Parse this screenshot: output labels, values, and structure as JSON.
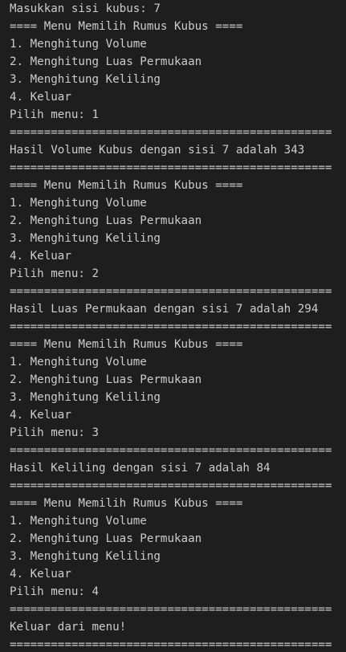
{
  "terminal": {
    "lines": [
      "Masukkan sisi kubus: 7",
      "==== Menu Memilih Rumus Kubus ====",
      "1. Menghitung Volume",
      "2. Menghitung Luas Permukaan",
      "3. Menghitung Keliling",
      "4. Keluar",
      "Pilih menu: 1",
      "===============================================",
      "Hasil Volume Kubus dengan sisi 7 adalah 343",
      "===============================================",
      "==== Menu Memilih Rumus Kubus ====",
      "1. Menghitung Volume",
      "2. Menghitung Luas Permukaan",
      "3. Menghitung Keliling",
      "4. Keluar",
      "Pilih menu: 2",
      "===============================================",
      "Hasil Luas Permukaan dengan sisi 7 adalah 294",
      "===============================================",
      "==== Menu Memilih Rumus Kubus ====",
      "1. Menghitung Volume",
      "2. Menghitung Luas Permukaan",
      "3. Menghitung Keliling",
      "4. Keluar",
      "Pilih menu: 3",
      "===============================================",
      "Hasil Keliling dengan sisi 7 adalah 84",
      "===============================================",
      "==== Menu Memilih Rumus Kubus ====",
      "1. Menghitung Volume",
      "2. Menghitung Luas Permukaan",
      "3. Menghitung Keliling",
      "4. Keluar",
      "Pilih menu: 4",
      "===============================================",
      "Keluar dari menu!",
      "==============================================="
    ]
  }
}
